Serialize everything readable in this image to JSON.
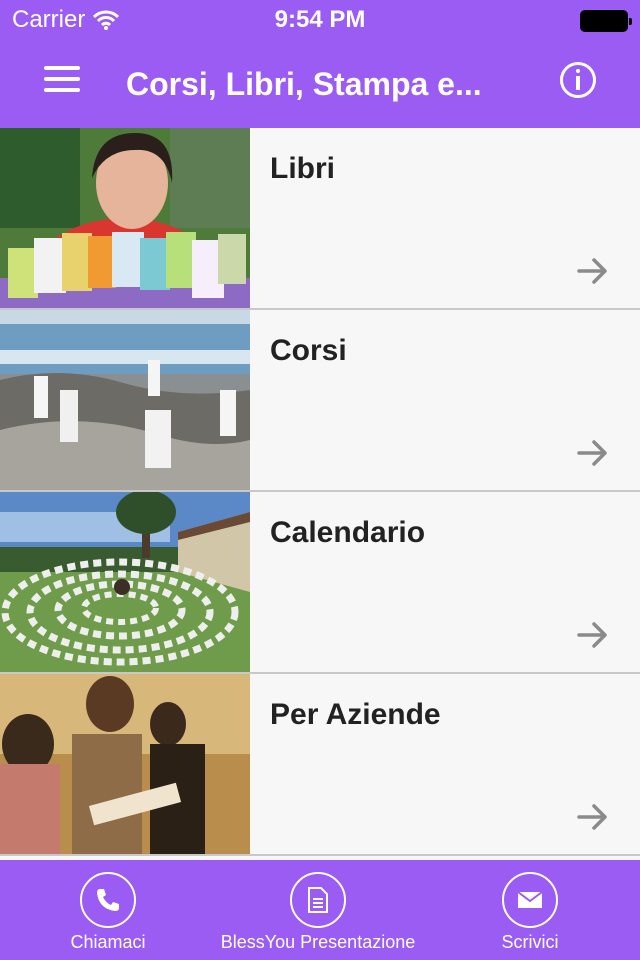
{
  "status": {
    "carrier": "Carrier",
    "time": "9:54 PM"
  },
  "nav": {
    "title": "Corsi, Libri, Stampa e..."
  },
  "items": [
    {
      "title": "Libri"
    },
    {
      "title": "Corsi"
    },
    {
      "title": "Calendario"
    },
    {
      "title": "Per Aziende"
    }
  ],
  "tabs": [
    {
      "label": "Chiamaci",
      "icon": "phone-icon"
    },
    {
      "label": "BlessYou Presentazione",
      "icon": "document-icon"
    },
    {
      "label": "Scrivici",
      "icon": "mail-icon"
    }
  ],
  "colors": {
    "accent": "#9a5cf2",
    "row_bg": "#f7f7f7",
    "separator": "#c8c8c8"
  }
}
